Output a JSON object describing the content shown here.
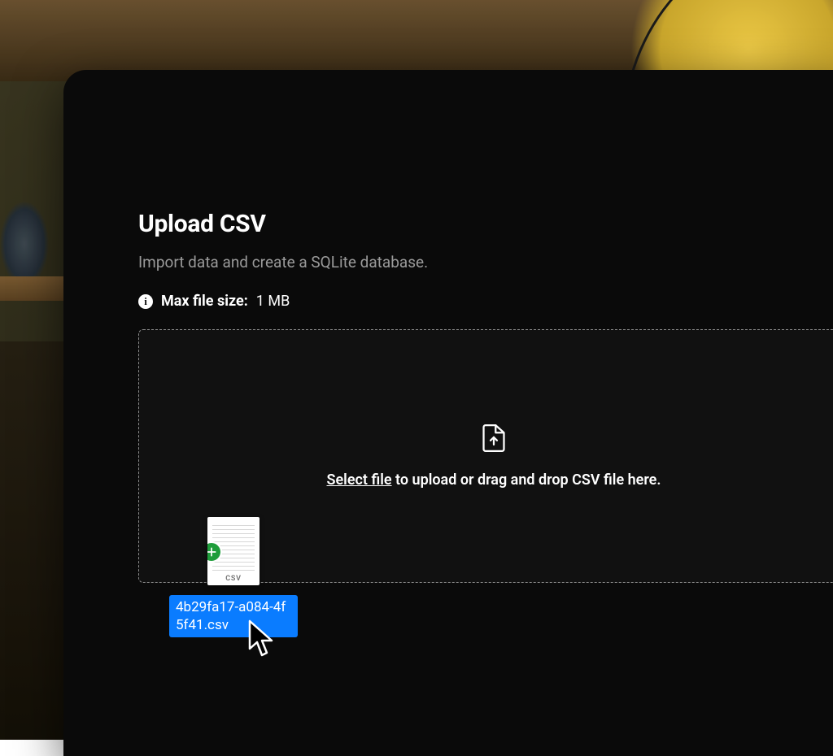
{
  "modal": {
    "title": "Upload CSV",
    "subtitle": "Import data and create a SQLite database.",
    "limit_label": "Max file size:",
    "limit_value": "1 MB"
  },
  "dropzone": {
    "select_link": "Select file",
    "rest_text": " to upload or drag and drop CSV file here."
  },
  "drag": {
    "ext_label": "CSV",
    "filename": "4b29fa17-a084-4f5f41.csv"
  }
}
